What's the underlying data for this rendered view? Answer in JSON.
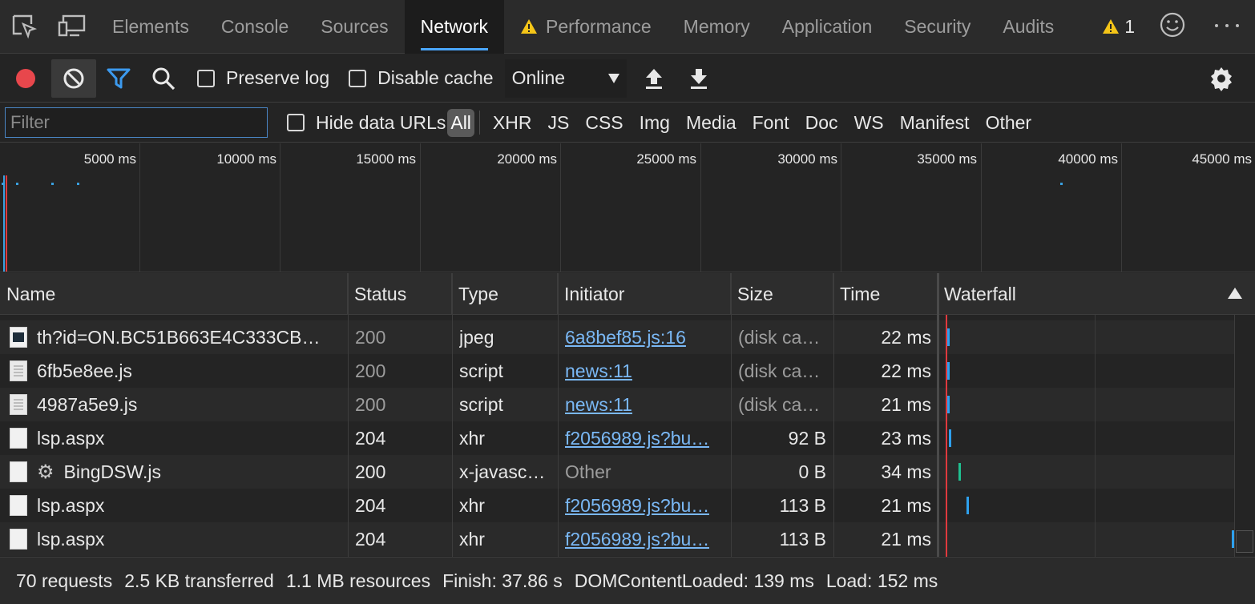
{
  "tabs": {
    "items": [
      {
        "label": "Elements"
      },
      {
        "label": "Console"
      },
      {
        "label": "Sources"
      },
      {
        "label": "Network"
      },
      {
        "label": "Performance"
      },
      {
        "label": "Memory"
      },
      {
        "label": "Application"
      },
      {
        "label": "Security"
      },
      {
        "label": "Audits"
      }
    ],
    "active": "Network",
    "warning_count": "1"
  },
  "toolbar": {
    "preserve_log_label": "Preserve log",
    "disable_cache_label": "Disable cache",
    "throttle_value": "Online"
  },
  "filter": {
    "placeholder": "Filter",
    "hide_data_urls_label": "Hide data URLs",
    "types": [
      "All",
      "XHR",
      "JS",
      "CSS",
      "Img",
      "Media",
      "Font",
      "Doc",
      "WS",
      "Manifest",
      "Other"
    ]
  },
  "overview": {
    "ticks": [
      "5000 ms",
      "10000 ms",
      "15000 ms",
      "20000 ms",
      "25000 ms",
      "30000 ms",
      "35000 ms",
      "40000 ms",
      "45000 ms"
    ]
  },
  "table": {
    "columns": {
      "name": "Name",
      "status": "Status",
      "type": "Type",
      "initiator": "Initiator",
      "size": "Size",
      "time": "Time",
      "waterfall": "Waterfall"
    },
    "rows": [
      {
        "name": "th?id=ON.BC51B663E4C333CB…",
        "status": "200",
        "type": "jpeg",
        "initiator": "6a8bef85.js:16",
        "size": "(disk ca…",
        "time": "22 ms",
        "icon": "image-file-icon"
      },
      {
        "name": "6fb5e8ee.js",
        "status": "200",
        "type": "script",
        "initiator": "news:11",
        "size": "(disk ca…",
        "time": "22 ms",
        "icon": "script-file-icon"
      },
      {
        "name": "4987a5e9.js",
        "status": "200",
        "type": "script",
        "initiator": "news:11",
        "size": "(disk ca…",
        "time": "21 ms",
        "icon": "script-file-icon"
      },
      {
        "name": "lsp.aspx",
        "status": "204",
        "type": "xhr",
        "initiator": "f2056989.js?bu…",
        "size": "92 B",
        "time": "23 ms",
        "icon": "blank-file-icon"
      },
      {
        "name": "BingDSW.js",
        "status": "200",
        "type": "x-javasc…",
        "initiator": "Other",
        "size": "0 B",
        "time": "34 ms",
        "icon": "blank-file-icon"
      },
      {
        "name": "lsp.aspx",
        "status": "204",
        "type": "xhr",
        "initiator": "f2056989.js?bu…",
        "size": "113 B",
        "time": "21 ms",
        "icon": "blank-file-icon"
      },
      {
        "name": "lsp.aspx",
        "status": "204",
        "type": "xhr",
        "initiator": "f2056989.js?bu…",
        "size": "113 B",
        "time": "21 ms",
        "icon": "blank-file-icon"
      }
    ]
  },
  "status_bar": {
    "requests": "70 requests",
    "transferred": "2.5 KB transferred",
    "resources": "1.1 MB resources",
    "finish": "Finish: 37.86 s",
    "dom_content_loaded": "DOMContentLoaded: 139 ms",
    "load": "Load: 152 ms"
  },
  "colors": {
    "accent": "#4aa6ff",
    "record": "#e8474c",
    "link": "#7ab8f5",
    "warning": "#f5c518",
    "waterfall_bar": "#2ea1ee"
  }
}
